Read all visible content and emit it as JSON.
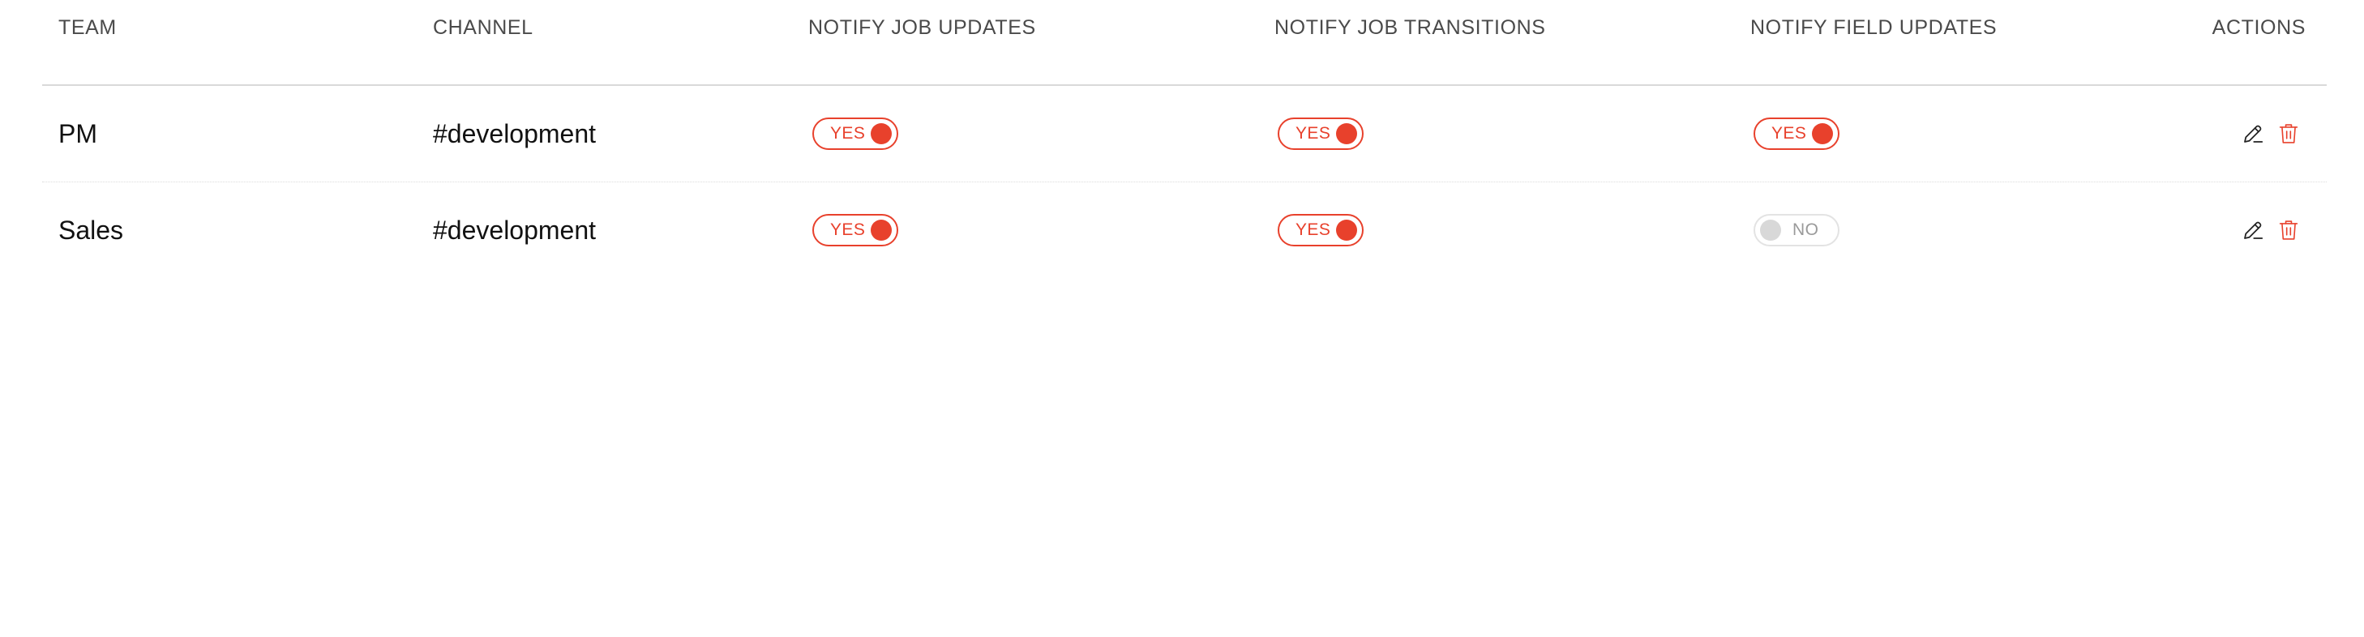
{
  "colors": {
    "accent": "#e8412c",
    "toggle_off_border": "#e3e3e3",
    "toggle_off_knob": "#d8d8d8",
    "header_text": "#4a4a4a",
    "divider": "#d9d9d9"
  },
  "table": {
    "headers": {
      "team": "TEAM",
      "channel": "CHANNEL",
      "notify_job_updates": "NOTIFY JOB UPDATES",
      "notify_job_transitions": "NOTIFY JOB TRANSITIONS",
      "notify_field_updates": "NOTIFY FIELD UPDATES",
      "actions": "ACTIONS"
    },
    "rows": [
      {
        "team": "PM",
        "channel": "#development",
        "notify_job_updates": {
          "state": true,
          "label": "YES"
        },
        "notify_job_transitions": {
          "state": true,
          "label": "YES"
        },
        "notify_field_updates": {
          "state": true,
          "label": "YES"
        },
        "actions": {
          "edit_icon": "pencil-icon",
          "delete_icon": "trash-icon"
        }
      },
      {
        "team": "Sales",
        "channel": "#development",
        "notify_job_updates": {
          "state": true,
          "label": "YES"
        },
        "notify_job_transitions": {
          "state": true,
          "label": "YES"
        },
        "notify_field_updates": {
          "state": false,
          "label": "NO"
        },
        "actions": {
          "edit_icon": "pencil-icon",
          "delete_icon": "trash-icon"
        }
      }
    ]
  }
}
